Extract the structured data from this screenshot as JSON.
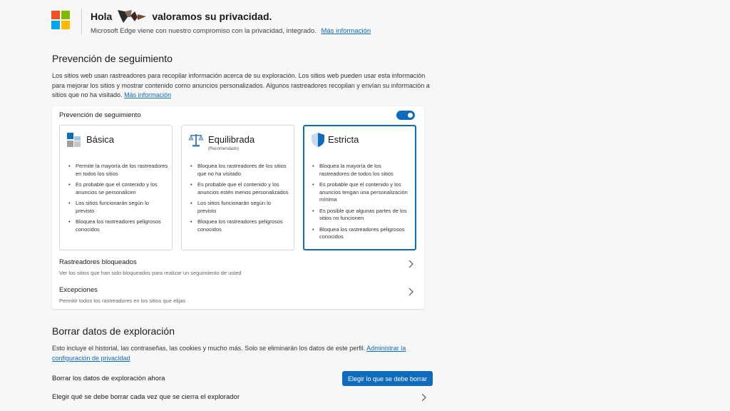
{
  "header": {
    "greeting": "Hola",
    "title_rest": "valoramos su privacidad.",
    "subtitle": "Microsoft Edge viene con nuestro compromiso con la privacidad, integrado.",
    "subtitle_link": "Más información"
  },
  "tracking": {
    "title": "Prevención de seguimiento",
    "description": "Los sitios web usan rastreadores para recopilar información acerca de su exploración. Los sitios web pueden usar esta información para mejorar los sitios y mostrar contenido como anuncios personalizados. Algunos rastreadores recopilan y envían su información a sitios que no ha visitado.",
    "description_link": "Más información",
    "card_label": "Prevención de seguimiento",
    "toggle_on": true,
    "options": [
      {
        "title": "Básica",
        "recommended": "",
        "icon": "basic-blocks-icon",
        "bullets": [
          "Permite la mayoría de los rastreadores en todos los sitios",
          "Es probable que el contenido y los anuncios se personalicen",
          "Los sitios funcionarán según lo previsto",
          "Bloquea los rastreadores peligrosos conocidos"
        ]
      },
      {
        "title": "Equilibrada",
        "recommended": "(Recomendado)",
        "icon": "scale-icon",
        "bullets": [
          "Bloquea los rastreadores de los sitios que no ha visitado",
          "Es probable que el contenido y los anuncios estén menos personalizados",
          "Los sitios funcionarán según lo previsto",
          "Bloquea los rastreadores peligrosos conocidos"
        ]
      },
      {
        "title": "Estricta",
        "recommended": "",
        "icon": "shield-icon",
        "bullets": [
          "Bloquea la mayoría de los rastreadores de todos los sitios",
          "Es probable que el contenido y los anuncios tengan una personalización mínima",
          "Es posible que algunas partes de los sitios no funcionen",
          "Bloquea los rastreadores peligrosos conocidos"
        ]
      }
    ],
    "blocked": {
      "title": "Rastreadores bloqueados",
      "subtitle": "Ver los sitios que han sido bloqueados para realizar un seguimiento de usted"
    },
    "exceptions": {
      "title": "Excepciones",
      "subtitle": "Permitir todos los rastreadores en los sitios que elijas"
    }
  },
  "clear": {
    "title": "Borrar datos de exploración",
    "description": "Esto incluye el historial, las contraseñas, las cookies y mucho más. Solo se eliminarán los datos de este perfil.",
    "description_link": "Administrar la configuración de privacidad",
    "now_label": "Borrar los datos de exploración ahora",
    "now_button": "Elegir lo que se debe borrar",
    "on_close_label": "Elegir qué se debe borrar cada vez que se cierra el explorador"
  },
  "colors": {
    "accent": "#0f6cbd",
    "ms_red": "#f25022",
    "ms_green": "#7fba00",
    "ms_blue": "#00a4ef",
    "ms_yellow": "#ffb900"
  }
}
